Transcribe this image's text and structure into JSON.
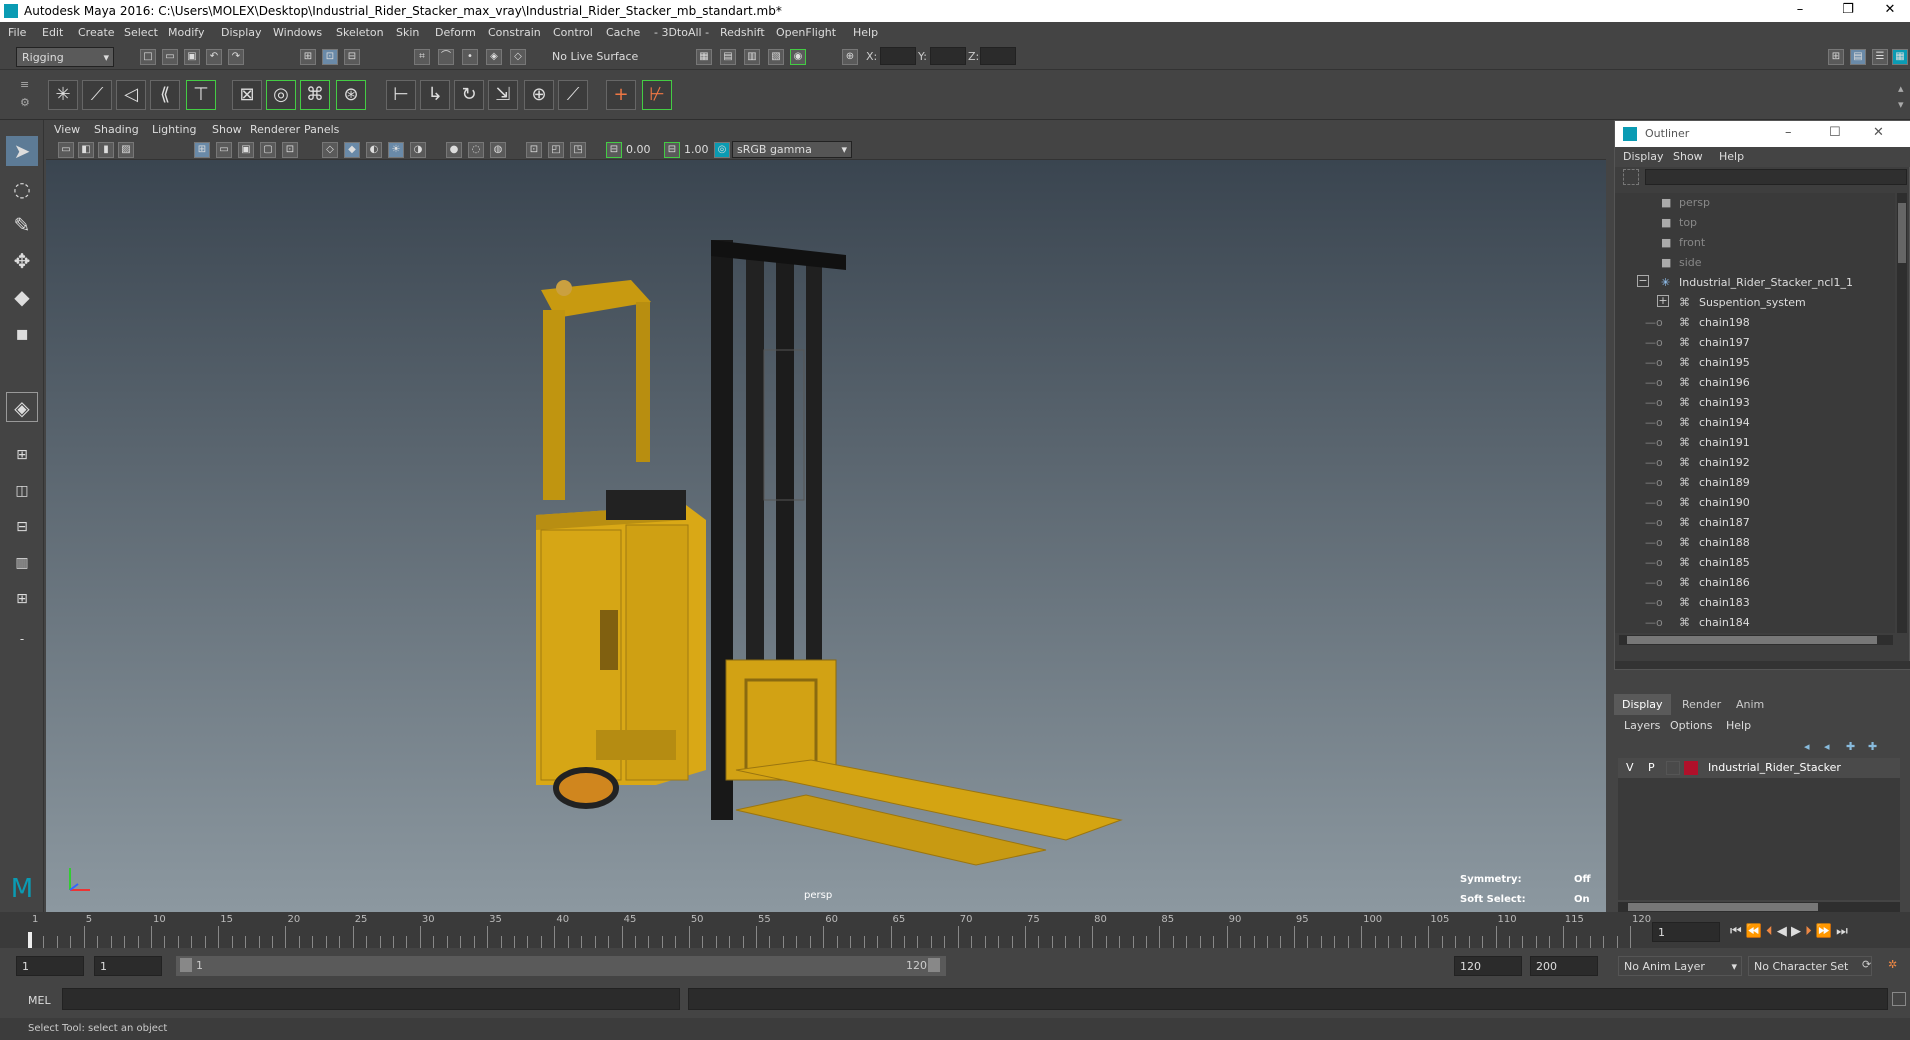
{
  "window": {
    "title": "Autodesk Maya 2016: C:\\Users\\MOLEX\\Desktop\\Industrial_Rider_Stacker_max_vray\\Industrial_Rider_Stacker_mb_standart.mb*",
    "minimize": "–",
    "restore": "❐",
    "close": "✕"
  },
  "menu": [
    "File",
    "Edit",
    "Create",
    "Select",
    "Modify",
    "Display",
    "Windows",
    "Skeleton",
    "Skin",
    "Deform",
    "Constrain",
    "Control",
    "Cache",
    "- 3DtoAll -",
    "Redshift",
    "OpenFlight",
    "Help"
  ],
  "status": {
    "mode": "Rigging",
    "live_surface": "No Live Surface",
    "x": "X:",
    "y": "Y:",
    "z": "Z:"
  },
  "viewport": {
    "menu": [
      "View",
      "Shading",
      "Lighting",
      "Show",
      "Renderer",
      "Panels"
    ],
    "near": "0.00",
    "far": "1.00",
    "color_mgmt": "sRGB gamma",
    "camera": "persp",
    "symmetry_label": "Symmetry:",
    "symmetry_value": "Off",
    "soft_label": "Soft Select:",
    "soft_value": "On"
  },
  "outliner": {
    "title": "Outliner",
    "menu": [
      "Display",
      "Show",
      "Help"
    ],
    "cameras": [
      "persp",
      "top",
      "front",
      "side"
    ],
    "root": "Industrial_Rider_Stacker_ncl1_1",
    "group": "Suspention_system",
    "items": [
      "chain198",
      "chain197",
      "chain195",
      "chain196",
      "chain193",
      "chain194",
      "chain191",
      "chain192",
      "chain189",
      "chain190",
      "chain187",
      "chain188",
      "chain185",
      "chain186",
      "chain183",
      "chain184"
    ]
  },
  "layers": {
    "tabs": [
      "Display",
      "Render",
      "Anim"
    ],
    "menu": [
      "Layers",
      "Options",
      "Help"
    ],
    "v": "V",
    "p": "P",
    "layer_name": "Industrial_Rider_Stacker",
    "layer_color": "#b0102a"
  },
  "timeline": {
    "ticks": [
      "1",
      "5",
      "10",
      "15",
      "20",
      "25",
      "30",
      "35",
      "40",
      "45",
      "50",
      "55",
      "60",
      "65",
      "70",
      "75",
      "80",
      "85",
      "90",
      "95",
      "100",
      "105",
      "110",
      "115",
      "120"
    ],
    "current": "1"
  },
  "range": {
    "start": "1",
    "playback_start": "1",
    "slider_start": "1",
    "slider_end": "120",
    "playback_end": "120",
    "end": "200",
    "anim_layer": "No Anim Layer",
    "char_set": "No Character Set"
  },
  "cmd": {
    "label": "MEL"
  },
  "help": {
    "text": "Select Tool: select an object"
  },
  "colors": {
    "accent": "#0a9bb3"
  }
}
